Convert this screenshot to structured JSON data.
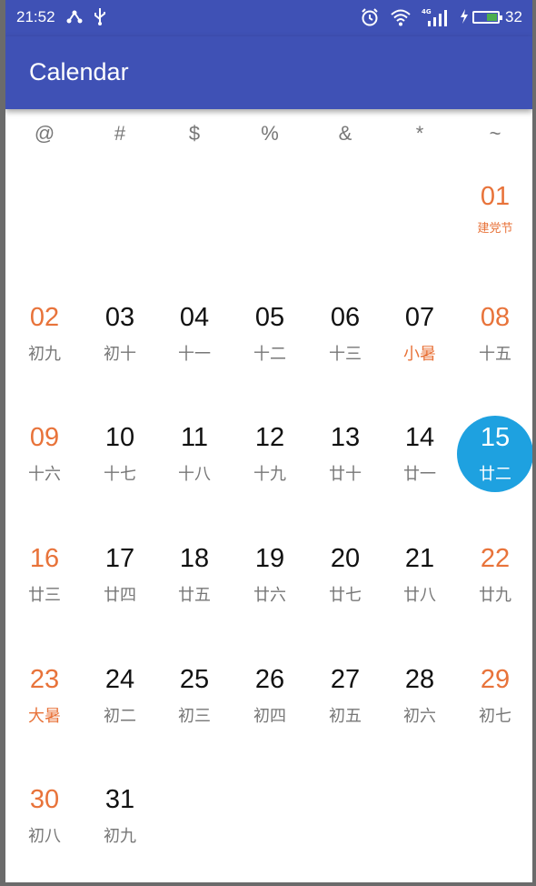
{
  "status_bar": {
    "time": "21:52",
    "network_label": "4G",
    "battery_level": "32"
  },
  "app_bar": {
    "title": "Calendar"
  },
  "weekdays": [
    "@",
    "#",
    "$",
    "%",
    "&",
    "*",
    "~"
  ],
  "colors": {
    "primary": "#3f51b5",
    "weekend": "#e8733a",
    "selected": "#1ea1e0",
    "text": "#111111",
    "lunar": "#777777"
  },
  "weeks": [
    [
      null,
      null,
      null,
      null,
      null,
      null,
      {
        "day": "01",
        "lunar": "建党节",
        "weekend": true,
        "festival": true
      }
    ],
    [
      {
        "day": "02",
        "lunar": "初九",
        "weekend": true
      },
      {
        "day": "03",
        "lunar": "初十"
      },
      {
        "day": "04",
        "lunar": "十一"
      },
      {
        "day": "05",
        "lunar": "十二"
      },
      {
        "day": "06",
        "lunar": "十三"
      },
      {
        "day": "07",
        "lunar": "小暑",
        "term": true
      },
      {
        "day": "08",
        "lunar": "十五",
        "weekend": true
      }
    ],
    [
      {
        "day": "09",
        "lunar": "十六",
        "weekend": true
      },
      {
        "day": "10",
        "lunar": "十七"
      },
      {
        "day": "11",
        "lunar": "十八"
      },
      {
        "day": "12",
        "lunar": "十九"
      },
      {
        "day": "13",
        "lunar": "廿十"
      },
      {
        "day": "14",
        "lunar": "廿一"
      },
      {
        "day": "15",
        "lunar": "廿二",
        "selected": true
      }
    ],
    [
      {
        "day": "16",
        "lunar": "廿三",
        "weekend": true
      },
      {
        "day": "17",
        "lunar": "廿四"
      },
      {
        "day": "18",
        "lunar": "廿五"
      },
      {
        "day": "19",
        "lunar": "廿六"
      },
      {
        "day": "20",
        "lunar": "廿七"
      },
      {
        "day": "21",
        "lunar": "廿八"
      },
      {
        "day": "22",
        "lunar": "廿九",
        "weekend": true
      }
    ],
    [
      {
        "day": "23",
        "lunar": "大暑",
        "weekend": true,
        "term": true
      },
      {
        "day": "24",
        "lunar": "初二"
      },
      {
        "day": "25",
        "lunar": "初三"
      },
      {
        "day": "26",
        "lunar": "初四"
      },
      {
        "day": "27",
        "lunar": "初五"
      },
      {
        "day": "28",
        "lunar": "初六"
      },
      {
        "day": "29",
        "lunar": "初七",
        "weekend": true
      }
    ],
    [
      {
        "day": "30",
        "lunar": "初八",
        "weekend": true
      },
      {
        "day": "31",
        "lunar": "初九"
      },
      null,
      null,
      null,
      null,
      null
    ]
  ]
}
